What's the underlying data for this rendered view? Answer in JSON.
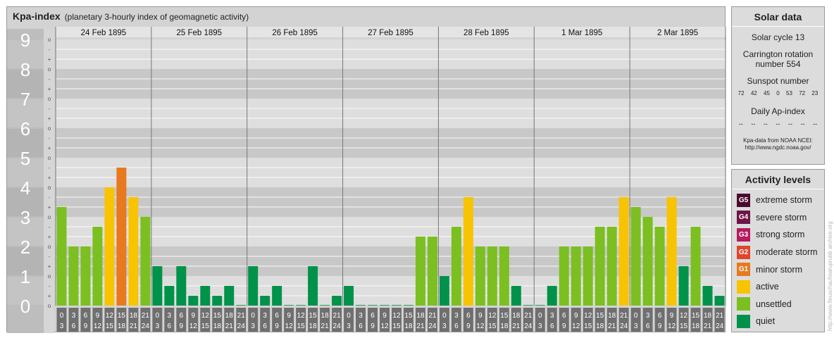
{
  "title": "Kpa-index",
  "subtitle": "(planetary 3-hourly index of geomagnetic activity)",
  "chart_data": {
    "type": "bar",
    "title": "Kpa-index",
    "subtitle": "(planetary 3-hourly index of geomagnetic activity)",
    "ylim": [
      0,
      9
    ],
    "y_ticks": [
      "0",
      "1",
      "2",
      "3",
      "4",
      "5",
      "6",
      "7",
      "8",
      "9"
    ],
    "sub_ticks": [
      "-",
      "o",
      "+"
    ],
    "days": [
      "24 Feb 1895",
      "25 Feb 1895",
      "26 Feb 1895",
      "27 Feb 1895",
      "28 Feb 1895",
      "1 Mar 1895",
      "2 Mar 1895"
    ],
    "slot_labels": [
      [
        "0",
        "3"
      ],
      [
        "3",
        "6"
      ],
      [
        "6",
        "9"
      ],
      [
        "9",
        "12"
      ],
      [
        "12",
        "15"
      ],
      [
        "15",
        "18"
      ],
      [
        "18",
        "21"
      ],
      [
        "21",
        "24"
      ]
    ],
    "values": [
      [
        3.333,
        2.0,
        2.0,
        2.667,
        4.0,
        4.667,
        3.667,
        3.0
      ],
      [
        1.333,
        0.667,
        1.333,
        0.333,
        0.667,
        0.333,
        0.667,
        0.0
      ],
      [
        1.333,
        0.333,
        0.667,
        0.0,
        0.0,
        1.333,
        0.0,
        0.333
      ],
      [
        0.667,
        0.0,
        0.0,
        0.0,
        0.0,
        0.0,
        2.333,
        2.333
      ],
      [
        1.0,
        2.667,
        3.667,
        2.0,
        2.0,
        2.0,
        0.667,
        0.0
      ],
      [
        0.0,
        0.667,
        2.0,
        2.0,
        2.0,
        2.667,
        2.667,
        3.667
      ],
      [
        3.333,
        3.0,
        2.667,
        3.667,
        1.333,
        2.667,
        0.667,
        0.333
      ]
    ],
    "grid": true
  },
  "solar": {
    "title": "Solar data",
    "cycle": "Solar cycle 13",
    "carrington": "Carrington rotation number 554",
    "sunspot_label": "Sunspot number",
    "sunspots": [
      "72",
      "42",
      "45",
      "0",
      "53",
      "72",
      "23"
    ],
    "ap_label": "Daily Ap-index",
    "ap_values": [
      "--",
      "--",
      "--",
      "--",
      "--",
      "--",
      "--"
    ],
    "source_line1": "Kpa-data from NOAA NCEI:",
    "source_line2": "http://www.ngdc.noaa.gov/"
  },
  "activity": {
    "title": "Activity levels",
    "levels": [
      {
        "code": "G5",
        "label": "extreme storm",
        "color": "#4a0a2c"
      },
      {
        "code": "G4",
        "label": "severe storm",
        "color": "#6e1446"
      },
      {
        "code": "G3",
        "label": "strong storm",
        "color": "#b7195e"
      },
      {
        "code": "G2",
        "label": "moderate storm",
        "color": "#e0452a"
      },
      {
        "code": "G1",
        "label": "minor storm",
        "color": "#e8791f"
      },
      {
        "code": "",
        "label": "active",
        "color": "#f8c300"
      },
      {
        "code": "",
        "label": "unsettled",
        "color": "#7bbf21"
      },
      {
        "code": "",
        "label": "quiet",
        "color": "#00924a"
      }
    ]
  },
  "watermark": "http://www.fleuschaufeiaruprubb archive.org"
}
